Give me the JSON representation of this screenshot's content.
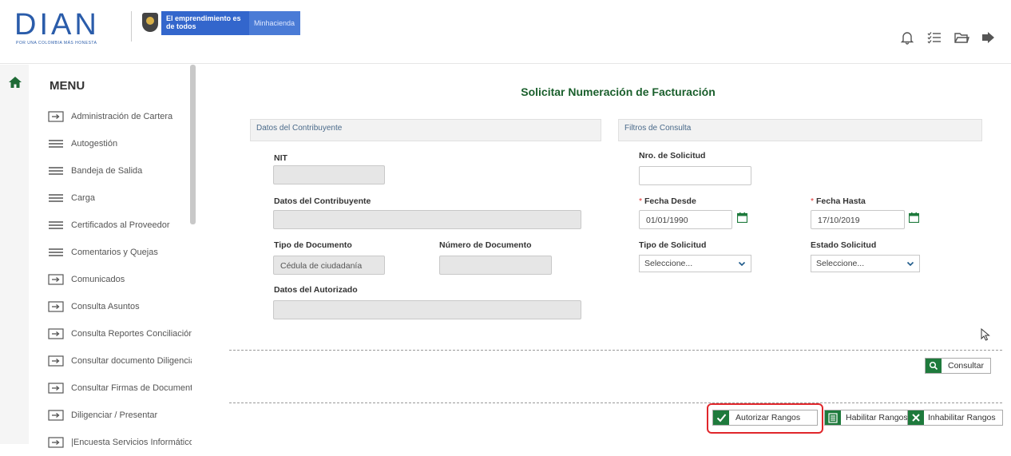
{
  "header": {
    "logo_word": "DIAN",
    "logo_tagline": "POR UNA COLOMBIA MÁS HONESTA",
    "gov_primary": "El emprendimiento es de todos",
    "gov_secondary": "Minhacienda",
    "icons": [
      "bell-icon",
      "checklist-icon",
      "folder-icon",
      "logout-icon"
    ]
  },
  "sidebar": {
    "title": "MENU",
    "items": [
      {
        "label": "Administración de Cartera",
        "icon": "enter-icon"
      },
      {
        "label": "Autogestión",
        "icon": "list-icon"
      },
      {
        "label": "Bandeja de Salida",
        "icon": "list-icon"
      },
      {
        "label": "Carga",
        "icon": "list-icon"
      },
      {
        "label": "Certificados al Proveedor",
        "icon": "list-icon"
      },
      {
        "label": "Comentarios y Quejas",
        "icon": "list-icon"
      },
      {
        "label": "Comunicados",
        "icon": "enter-icon"
      },
      {
        "label": "Consulta Asuntos",
        "icon": "enter-icon"
      },
      {
        "label": "Consulta Reportes Conciliación F",
        "icon": "enter-icon"
      },
      {
        "label": "Consultar documento Diligenciad",
        "icon": "enter-icon"
      },
      {
        "label": "Consultar Firmas de Documento",
        "icon": "enter-icon"
      },
      {
        "label": "Diligenciar / Presentar",
        "icon": "enter-icon"
      },
      {
        "label": "|Encuesta Servicios Informático E",
        "icon": "enter-icon"
      }
    ]
  },
  "main": {
    "title": "Solicitar Numeración de Facturación",
    "contribuyente": {
      "section": "Datos del Contribuyente",
      "nit_label": "NIT",
      "nit_value": "",
      "datos_label": "Datos del Contribuyente",
      "datos_value": "",
      "tipo_doc_label": "Tipo de Documento",
      "tipo_doc_value": "Cédula de ciudadanía",
      "num_doc_label": "Número de Documento",
      "num_doc_value": "",
      "autorizado_label": "Datos del Autorizado",
      "autorizado_value": ""
    },
    "filtros": {
      "section": "Filtros de Consulta",
      "nro_label": "Nro. de Solicitud",
      "nro_value": "",
      "desde_req": "*",
      "desde_label": "Fecha Desde",
      "desde_value": "01/01/1990",
      "hasta_req": "*",
      "hasta_label": "Fecha Hasta",
      "hasta_value": "17/10/2019",
      "tipo_label": "Tipo de Solicitud",
      "tipo_value": "Seleccione...",
      "estado_label": "Estado Solicitud",
      "estado_value": "Seleccione..."
    },
    "buttons": {
      "consultar": "Consultar",
      "autorizar": "Autorizar Rangos",
      "habilitar": "Habilitar Rangos",
      "inhabilitar": "Inhabilitar Rangos"
    }
  },
  "colors": {
    "brand_blue": "#2a5caa",
    "title_green": "#1a5f2c",
    "button_green": "#1e7a3c",
    "highlight_red": "#e0262b"
  }
}
